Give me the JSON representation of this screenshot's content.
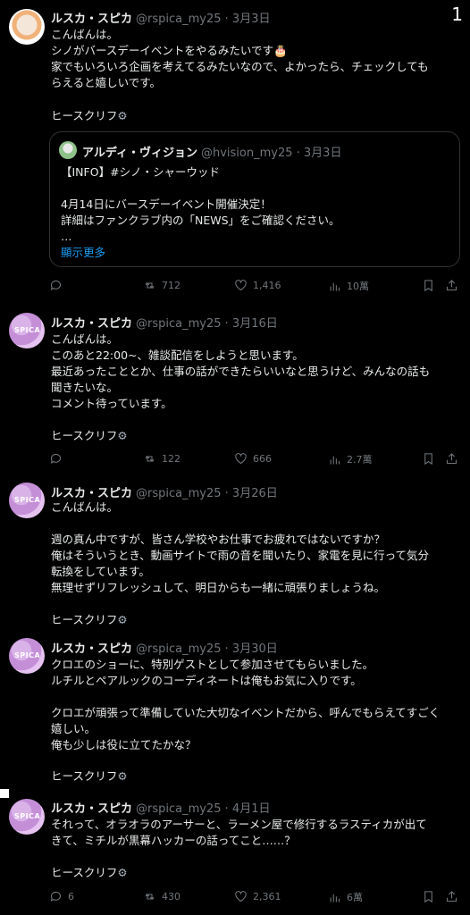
{
  "counter": "1",
  "author": {
    "name": "ルスカ・スピカ",
    "handle": "@rspica_my25"
  },
  "signature": "ヒースクリフ",
  "tweets": [
    {
      "date": "3月3日",
      "text": "こんばんは。\nシノがバースデーイベントをやるみたいです🎂\n家でもいろいろ企画を考えてるみたいなので、よかったら、チェックしても\nらえると嬉しいです。",
      "quote": {
        "name": "アルディ・ヴィジョン",
        "handle": "@hvision_my25",
        "date": "3月3日",
        "text": "【INFO】#シノ・シャーウッド\n\n4月14日にバースデーイベント開催決定！\n詳細はファンクラブ内の「NEWS」をご確認ください。\n…",
        "more": "顯示更多"
      },
      "replies": "",
      "retweets": "712",
      "likes": "1,416",
      "views": "10萬"
    },
    {
      "date": "3月16日",
      "text": "こんばんは。\nこのあと22:00~、雑談配信をしようと思います。\n最近あったこととか、仕事の話ができたらいいなと思うけど、みんなの話も\n聞きたいな。\nコメント待っています。",
      "replies": "",
      "retweets": "122",
      "likes": "666",
      "views": "2.7萬"
    },
    {
      "date": "3月26日",
      "text": "こんばんは。\n\n週の真ん中ですが、皆さん学校やお仕事でお疲れではないですか？\n俺はそういうとき、動画サイトで雨の音を聞いたり、家電を見に行って気分\n転換をしています。\n無理せずリフレッシュして、明日からも一緒に頑張りましょうね。"
    },
    {
      "date": "3月30日",
      "text": "クロエのショーに、特別ゲストとして参加させてもらいました。\nルチルとペアルックのコーディネートは俺もお気に入りです。\n\nクロエが頑張って準備していた大切なイベントだから、呼んでもらえてすごく\n嬉しい。\n俺も少しは役に立てたかな？"
    },
    {
      "date": "4月1日",
      "text": "それって、オラオラのアーサーと、ラーメン屋で修行するラスティカが出て\nきて、ミチルが黒幕ハッカーの話ってこと……？",
      "replies": "6",
      "retweets": "430",
      "likes": "2,361",
      "views": "6萬"
    }
  ]
}
